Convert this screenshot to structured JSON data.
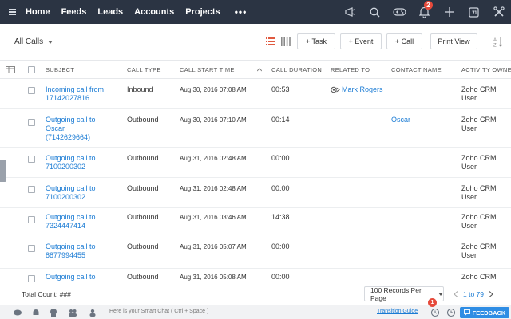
{
  "topnav": {
    "items": [
      "Home",
      "Feeds",
      "Leads",
      "Accounts",
      "Projects"
    ],
    "more": "•••",
    "notification_count": "2"
  },
  "toolbar": {
    "view": "All Calls",
    "task_label": "+ Task",
    "event_label": "+ Event",
    "call_label": "+ Call",
    "print_label": "Print View"
  },
  "table": {
    "columns": [
      "SUBJECT",
      "CALL TYPE",
      "CALL START TIME",
      "CALL DURATION",
      "RELATED TO",
      "CONTACT NAME",
      "ACTIVITY OWNER"
    ],
    "rows": [
      {
        "subject": "Incoming call from 17142027816",
        "type": "Inbound",
        "start": "Aug 30, 2016 07:08 AM",
        "duration": "00:53",
        "related": "Mark Rogers",
        "contact": "",
        "owner": "Zoho CRM User"
      },
      {
        "subject": "Outgoing call to Oscar (7142629664)",
        "type": "Outbound",
        "start": "Aug 30, 2016 07:10 AM",
        "duration": "00:14",
        "related": "",
        "contact": "Oscar",
        "owner": "Zoho CRM User"
      },
      {
        "subject": "Outgoing call to 7100200302",
        "type": "Outbound",
        "start": "Aug 31, 2016 02:48 AM",
        "duration": "00:00",
        "related": "",
        "contact": "",
        "owner": "Zoho CRM User"
      },
      {
        "subject": "Outgoing call to 7100200302",
        "type": "Outbound",
        "start": "Aug 31, 2016 02:48 AM",
        "duration": "00:00",
        "related": "",
        "contact": "",
        "owner": "Zoho CRM User"
      },
      {
        "subject": "Outgoing call to 7324447414",
        "type": "Outbound",
        "start": "Aug 31, 2016 03:46 AM",
        "duration": "14:38",
        "related": "",
        "contact": "",
        "owner": "Zoho CRM User"
      },
      {
        "subject": "Outgoing call to 8877994455",
        "type": "Outbound",
        "start": "Aug 31, 2016 05:07 AM",
        "duration": "00:00",
        "related": "",
        "contact": "",
        "owner": "Zoho CRM User"
      },
      {
        "subject": "Outgoing call to",
        "type": "Outbound",
        "start": "Aug 31, 2016 05:08 AM",
        "duration": "00:00",
        "related": "",
        "contact": "",
        "owner": "Zoho CRM"
      }
    ]
  },
  "footer": {
    "total": "Total Count: ###",
    "per_page": "100 Records Per Page",
    "pager_range": "1 to 79"
  },
  "chatbar": {
    "placeholder": "Here is your Smart Chat ( Ctrl + Space )",
    "guide": "Transition Guide",
    "feedback": "FEEDBACK",
    "alert_count": "1"
  },
  "colors": {
    "topbar": "#2b3443",
    "link": "#1a7bd4",
    "badge": "#e64a3b",
    "feedback": "#2f8de4"
  }
}
